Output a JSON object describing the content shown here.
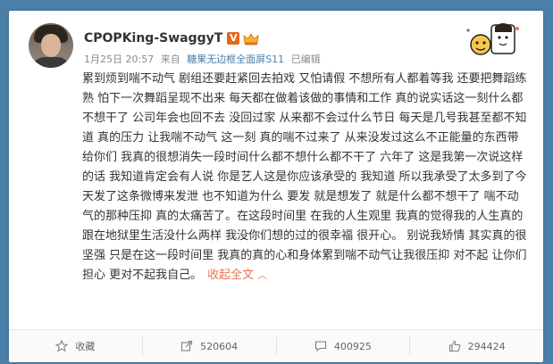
{
  "post": {
    "nickname": "CPOPKing-SwaggyT",
    "verified_mark": "V",
    "time": "1月25日 20:57",
    "source_prefix": "来自",
    "device": "糖果无边框全面屏S11",
    "edited": "已编辑",
    "body": "累到烦到喘不动气 剧组还要赶紧回去拍戏 又怕请假 不想所有人都着等我 还要把舞蹈练熟 怕下一次舞蹈呈现不出来 每天都在做着该做的事情和工作 真的说实话这一刻什么都不想干了 公司年会也回不去 没回过家 从来都不会过什么节日 每天是几号我甚至都不知道 真的压力 让我喘不动气 这一刻 真的喘不过来了 从来没发过这么不正能量的东西带给你们 我真的很想消失一段时间什么都不想什么都不干了 六年了 这是我第一次说这样的话 我知道肯定会有人说 你是艺人这是你应该承受的 我知道 所以我承受了太多到了今天发了这条微博来发泄 也不知道为什么 要发 就是想发了 就是什么都不想干了 喘不动气的那种压抑 真的太痛苦了。在这段时间里 在我的人生观里 我真的觉得我的人生真的跟在地狱里生活没什么两样 我没你们想的过的很幸福 很开心。 别说我矫情 其实真的很坚强 只是在这一段时间里 我真的真的心和身体累到喘不动气让我很压抑 对不起 让你们担心 更对不起我自己。",
    "collapse_label": "收起全文"
  },
  "actions": [
    {
      "icon": "star-icon",
      "label": "收藏"
    },
    {
      "icon": "share-icon",
      "label": "520604"
    },
    {
      "icon": "comment-icon",
      "label": "400925"
    },
    {
      "icon": "like-icon",
      "label": "294424"
    }
  ],
  "colors": {
    "background": "#4a7fa8",
    "link": "#4a7fa8",
    "collapse": "#eb7350",
    "verified": "#e8651b"
  }
}
